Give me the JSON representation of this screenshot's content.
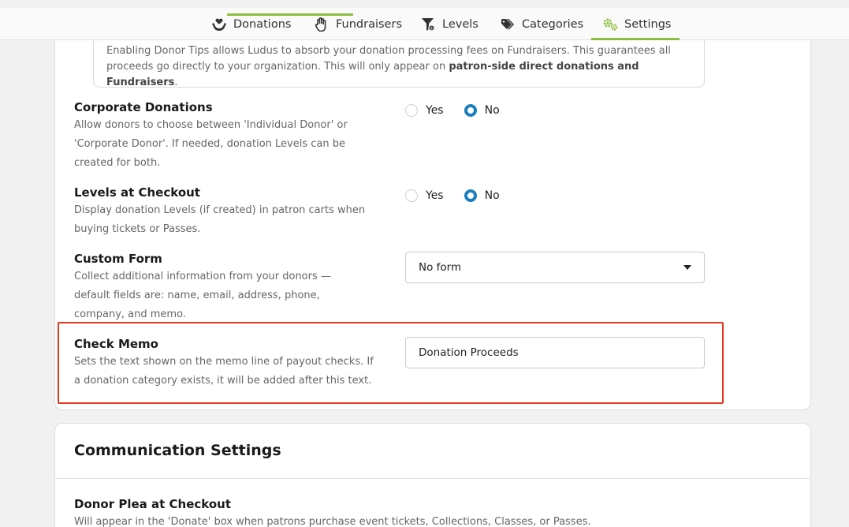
{
  "tabs": [
    {
      "label": "Donations",
      "icon": "hand-heart-icon"
    },
    {
      "label": "Fundraisers",
      "icon": "raised-hand-icon"
    },
    {
      "label": "Levels",
      "icon": "levels-filter-icon"
    },
    {
      "label": "Categories",
      "icon": "tags-icon"
    },
    {
      "label": "Settings",
      "icon": "gears-icon",
      "active": true
    }
  ],
  "colors": {
    "accent": "#8cbf3f",
    "radio_checked": "#1a7fbf",
    "highlight": "#e0381f"
  },
  "donor_tips": {
    "text_1": "Enabling Donor Tips allows Ludus to absorb your donation processing fees on Fundraisers. This guarantees all proceeds go directly to your organization. This will only appear on ",
    "text_bold": "patron-side direct donations and Fundraisers",
    "text_end": "."
  },
  "corporate_donations": {
    "title": "Corporate Donations",
    "description": "Allow donors to choose between 'Individual Donor' or 'Corporate Donor'. If needed, donation Levels can be created for both.",
    "yes_label": "Yes",
    "no_label": "No",
    "selected": "No"
  },
  "levels_at_checkout": {
    "title": "Levels at Checkout",
    "description": "Display donation Levels (if created) in patron carts when buying tickets or Passes.",
    "yes_label": "Yes",
    "no_label": "No",
    "selected": "No"
  },
  "custom_form": {
    "title": "Custom Form",
    "description": "Collect additional information from your donors — default fields are: name, email, address, phone, company, and memo.",
    "selected_option": "No form"
  },
  "check_memo": {
    "title": "Check Memo",
    "description": "Sets the text shown on the memo line of payout checks. If a donation category exists, it will be added after this text.",
    "value": "Donation Proceeds"
  },
  "communication": {
    "title": "Communication Settings",
    "donor_plea_title": "Donor Plea at Checkout",
    "donor_plea_description": "Will appear in the 'Donate' box when patrons purchase event tickets, Collections, Classes, or Passes."
  }
}
